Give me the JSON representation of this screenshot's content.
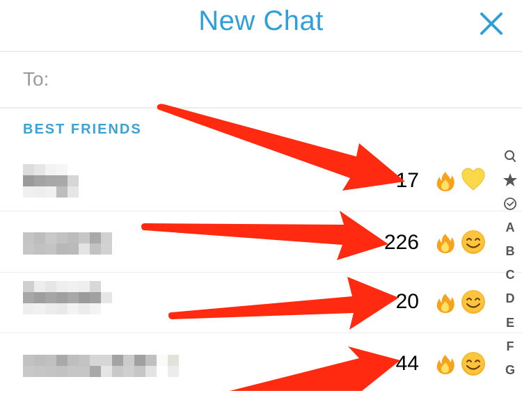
{
  "header": {
    "title": "New Chat",
    "close_icon": "close-icon",
    "accent_color": "#2f9fd9"
  },
  "to_field": {
    "label": "To:",
    "value": "",
    "placeholder": ""
  },
  "section": {
    "label": "BEST FRIENDS"
  },
  "friends": [
    {
      "name": "[pixelated name]",
      "streak": "17",
      "streak_icon": "fire-emoji",
      "status_emoji": "yellow-heart-emoji"
    },
    {
      "name": "[pixelated name]",
      "streak": "226",
      "streak_icon": "fire-emoji",
      "status_emoji": "smiling-face-emoji"
    },
    {
      "name": "[pixelated name]",
      "streak": "20",
      "streak_icon": "fire-emoji",
      "status_emoji": "smiling-face-emoji"
    },
    {
      "name": "[pixelated name]",
      "streak": "44",
      "streak_icon": "fire-emoji",
      "status_emoji": "smiling-face-emoji"
    }
  ],
  "index_bar": {
    "icons": [
      "search-icon",
      "star-icon",
      "check-circle-icon"
    ],
    "letters": [
      "A",
      "B",
      "C",
      "D",
      "E",
      "F",
      "G"
    ]
  },
  "annotations": {
    "arrow_color": "#ff2a10",
    "arrow_count": 4
  }
}
